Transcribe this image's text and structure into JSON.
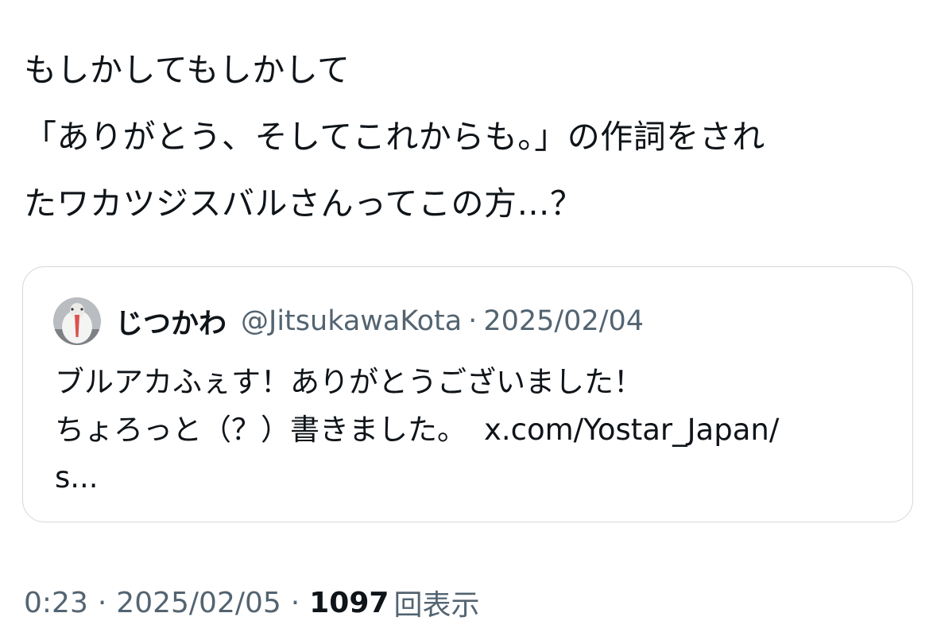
{
  "tweet": {
    "lines": [
      "もしかしてもしかして",
      "「ありがとう、そしてこれからも。」の作詞をされ",
      "たワカツジスバルさんってこの方…？"
    ],
    "time": "0:23",
    "separator": "·",
    "date": "2025/02/05",
    "views_count": "1097",
    "views_label": "回表示"
  },
  "quote": {
    "avatar_icon": "avatar-image",
    "display_name": "じつかわ",
    "handle": "@JitsukawaKota",
    "separator": "·",
    "date": "2025/02/04",
    "line1": "ブルアカふぇす！ありがとうございました！",
    "line2_text": "ちょろっと（？）書きました。",
    "line2_link": "x.com/Yostar_Japan/",
    "line3": "s..."
  },
  "colors": {
    "text_primary": "#0f1419",
    "text_secondary": "#536471",
    "card_border": "#d3d8dc"
  }
}
